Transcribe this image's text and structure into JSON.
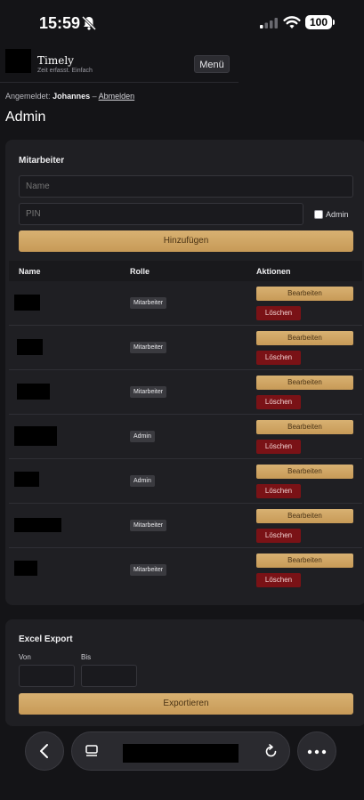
{
  "status": {
    "time": "15:59",
    "battery": "100"
  },
  "header": {
    "brand": "Timely",
    "tagline": "Zeit erfasst. Einfach",
    "menu_label": "Menü"
  },
  "session": {
    "prefix": "Angemeldet:",
    "user": "Johannes",
    "separator": "–",
    "logout": "Abmelden"
  },
  "page": {
    "title": "Admin"
  },
  "employees": {
    "title": "Mitarbeiter",
    "name_placeholder": "Name",
    "pin_placeholder": "PIN",
    "admin_label": "Admin",
    "add_label": "Hinzufügen",
    "columns": [
      "Name",
      "Rolle",
      "Aktionen"
    ],
    "edit_label": "Bearbeiten",
    "delete_label": "Löschen",
    "rows": [
      {
        "role": "Mitarbeiter"
      },
      {
        "role": "Mitarbeiter"
      },
      {
        "role": "Mitarbeiter"
      },
      {
        "role": "Admin"
      },
      {
        "role": "Admin"
      },
      {
        "role": "Mitarbeiter"
      },
      {
        "role": "Mitarbeiter"
      }
    ]
  },
  "export": {
    "title": "Excel Export",
    "from_label": "Von",
    "to_label": "Bis",
    "button_label": "Exportieren"
  },
  "browser": {
    "icons": [
      "back-icon",
      "tabs-icon",
      "reload-icon",
      "more-icon"
    ]
  },
  "colors": {
    "background": "#141417",
    "card": "#1f1f23",
    "accent_gold": "#cfa263",
    "danger": "#7a1216"
  }
}
